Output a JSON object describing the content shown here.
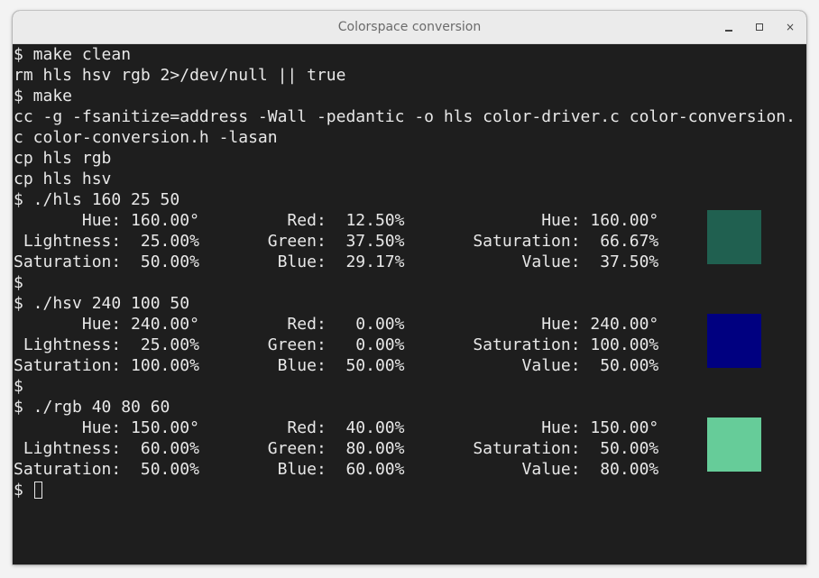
{
  "window": {
    "title": "Colorspace conversion",
    "controls": {
      "minimize": "minimize",
      "maximize": "maximize",
      "close": "×"
    }
  },
  "terminal": {
    "lines": [
      "$ make clean",
      "rm hls hsv rgb 2>/dev/null || true",
      "$ make",
      "cc -g -fsanitize=address -Wall -pedantic -o hls color-driver.c color-conversion.",
      "c color-conversion.h -lasan",
      "cp hls rgb",
      "cp hls hsv",
      "$ ./hls 160 25 50",
      "       Hue: 160.00°         Red:  12.50%              Hue: 160.00°",
      " Lightness:  25.00%       Green:  37.50%       Saturation:  66.67%",
      "Saturation:  50.00%        Blue:  29.17%            Value:  37.50%",
      "$",
      "$ ./hsv 240 100 50",
      "       Hue: 240.00°         Red:   0.00%              Hue: 240.00°",
      " Lightness:  25.00%       Green:   0.00%       Saturation: 100.00%",
      "Saturation: 100.00%        Blue:  50.00%            Value:  50.00%",
      "$",
      "$ ./rgb 40 80 60",
      "       Hue: 150.00°         Red:  40.00%              Hue: 150.00°",
      " Lightness:  60.00%       Green:  80.00%       Saturation:  50.00%",
      "Saturation:  50.00%        Blue:  60.00%            Value:  80.00%"
    ],
    "prompt": "$ "
  },
  "swatches": [
    {
      "color": "#206050"
    },
    {
      "color": "#000080"
    },
    {
      "color": "#66cc99"
    }
  ],
  "colors": {
    "terminal_bg": "#1e1e1e",
    "terminal_fg": "#e8e8e8",
    "titlebar_bg": "#ebebeb"
  }
}
